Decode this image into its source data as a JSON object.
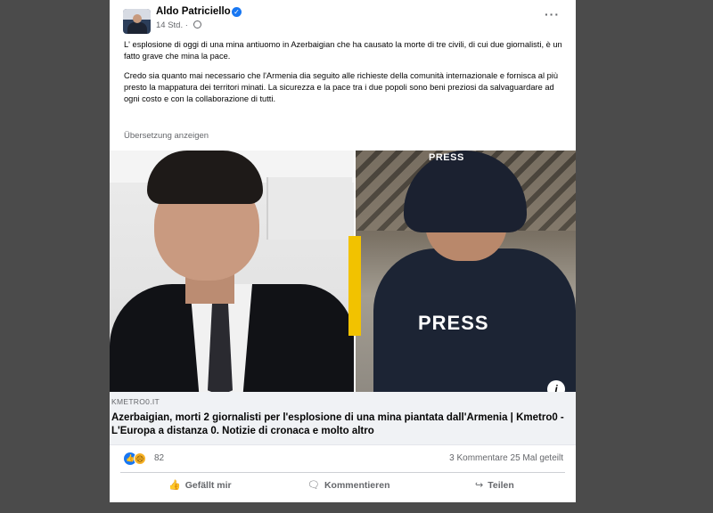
{
  "post": {
    "author": "Aldo Patriciello",
    "time": "14 Std. ·",
    "more_label": "···",
    "paragraph1": "L' esplosione di oggi di una mina antiuomo in Azerbaigian che ha causato la morte di tre civili, di cui due giornalisti, è un fatto grave che mina la pace.",
    "paragraph2": "Credo sia quanto mai necessario che l'Armenia dia seguito alle richieste della comunità internazionale e fornisca al più presto la mappatura dei territori minati. La sicurezza e la pace tra i due popoli sono beni preziosi da salvaguardare ad ogni costo e con la collaborazione di tutti.",
    "translate_label": "Übersetzung anzeigen"
  },
  "image": {
    "helmet_text": "PRESS",
    "vest_text": "PRESS"
  },
  "link_preview": {
    "domain": "KMETRO0.IT",
    "title": "Azerbaigian, morti 2 giornalisti per l'esplosione di una mina piantata dall'Armenia | Kmetro0 - L'Europa a distanza 0. Notizie di cronaca e molto altro"
  },
  "stats": {
    "reaction_count": "82",
    "comments_shares": "3 Kommentare  25 Mal geteilt"
  },
  "actions": {
    "like": "Gefällt mir",
    "comment": "Kommentieren",
    "share": "Teilen"
  },
  "icons": {
    "verified": "verified-badge-icon",
    "globe": "globe-icon",
    "like": "thumbs-up-icon",
    "sad": "sad-face-icon",
    "comment": "comment-icon",
    "share": "share-icon",
    "info": "info-icon"
  },
  "colors": {
    "accent": "#1877f2",
    "divider_yellow": "#f2c200",
    "backdrop": "#4b4b4b"
  }
}
